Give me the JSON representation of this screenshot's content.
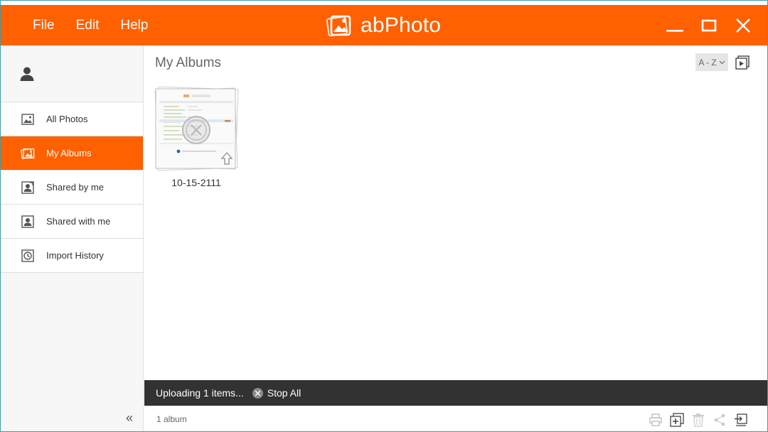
{
  "app": {
    "title": "abPhoto",
    "accent_color": "#ff6000"
  },
  "menu": [
    {
      "label": "File"
    },
    {
      "label": "Edit"
    },
    {
      "label": "Help"
    }
  ],
  "window_controls": [
    "minimize-icon",
    "maximize-icon",
    "close-icon"
  ],
  "sidebar": {
    "user_icon": "user-icon",
    "items": [
      {
        "label": "All Photos",
        "icon": "photo-icon",
        "active": false
      },
      {
        "label": "My Albums",
        "icon": "album-icon",
        "active": true
      },
      {
        "label": "Shared by me",
        "icon": "shared-by-me-icon",
        "active": false
      },
      {
        "label": "Shared with me",
        "icon": "shared-with-me-icon",
        "active": false
      },
      {
        "label": "Import History",
        "icon": "history-icon",
        "active": false
      }
    ],
    "collapse_label": "«"
  },
  "main": {
    "title": "My Albums",
    "sort_label": "A - Z",
    "albums": [
      {
        "name": "10-15-2111"
      }
    ]
  },
  "upload": {
    "status": "Uploading 1 items...",
    "stop_label": "Stop All"
  },
  "status_bar": {
    "count": "1 album",
    "tools": [
      "print-icon",
      "add-to-album-icon",
      "delete-icon",
      "share-icon",
      "export-icon"
    ]
  }
}
